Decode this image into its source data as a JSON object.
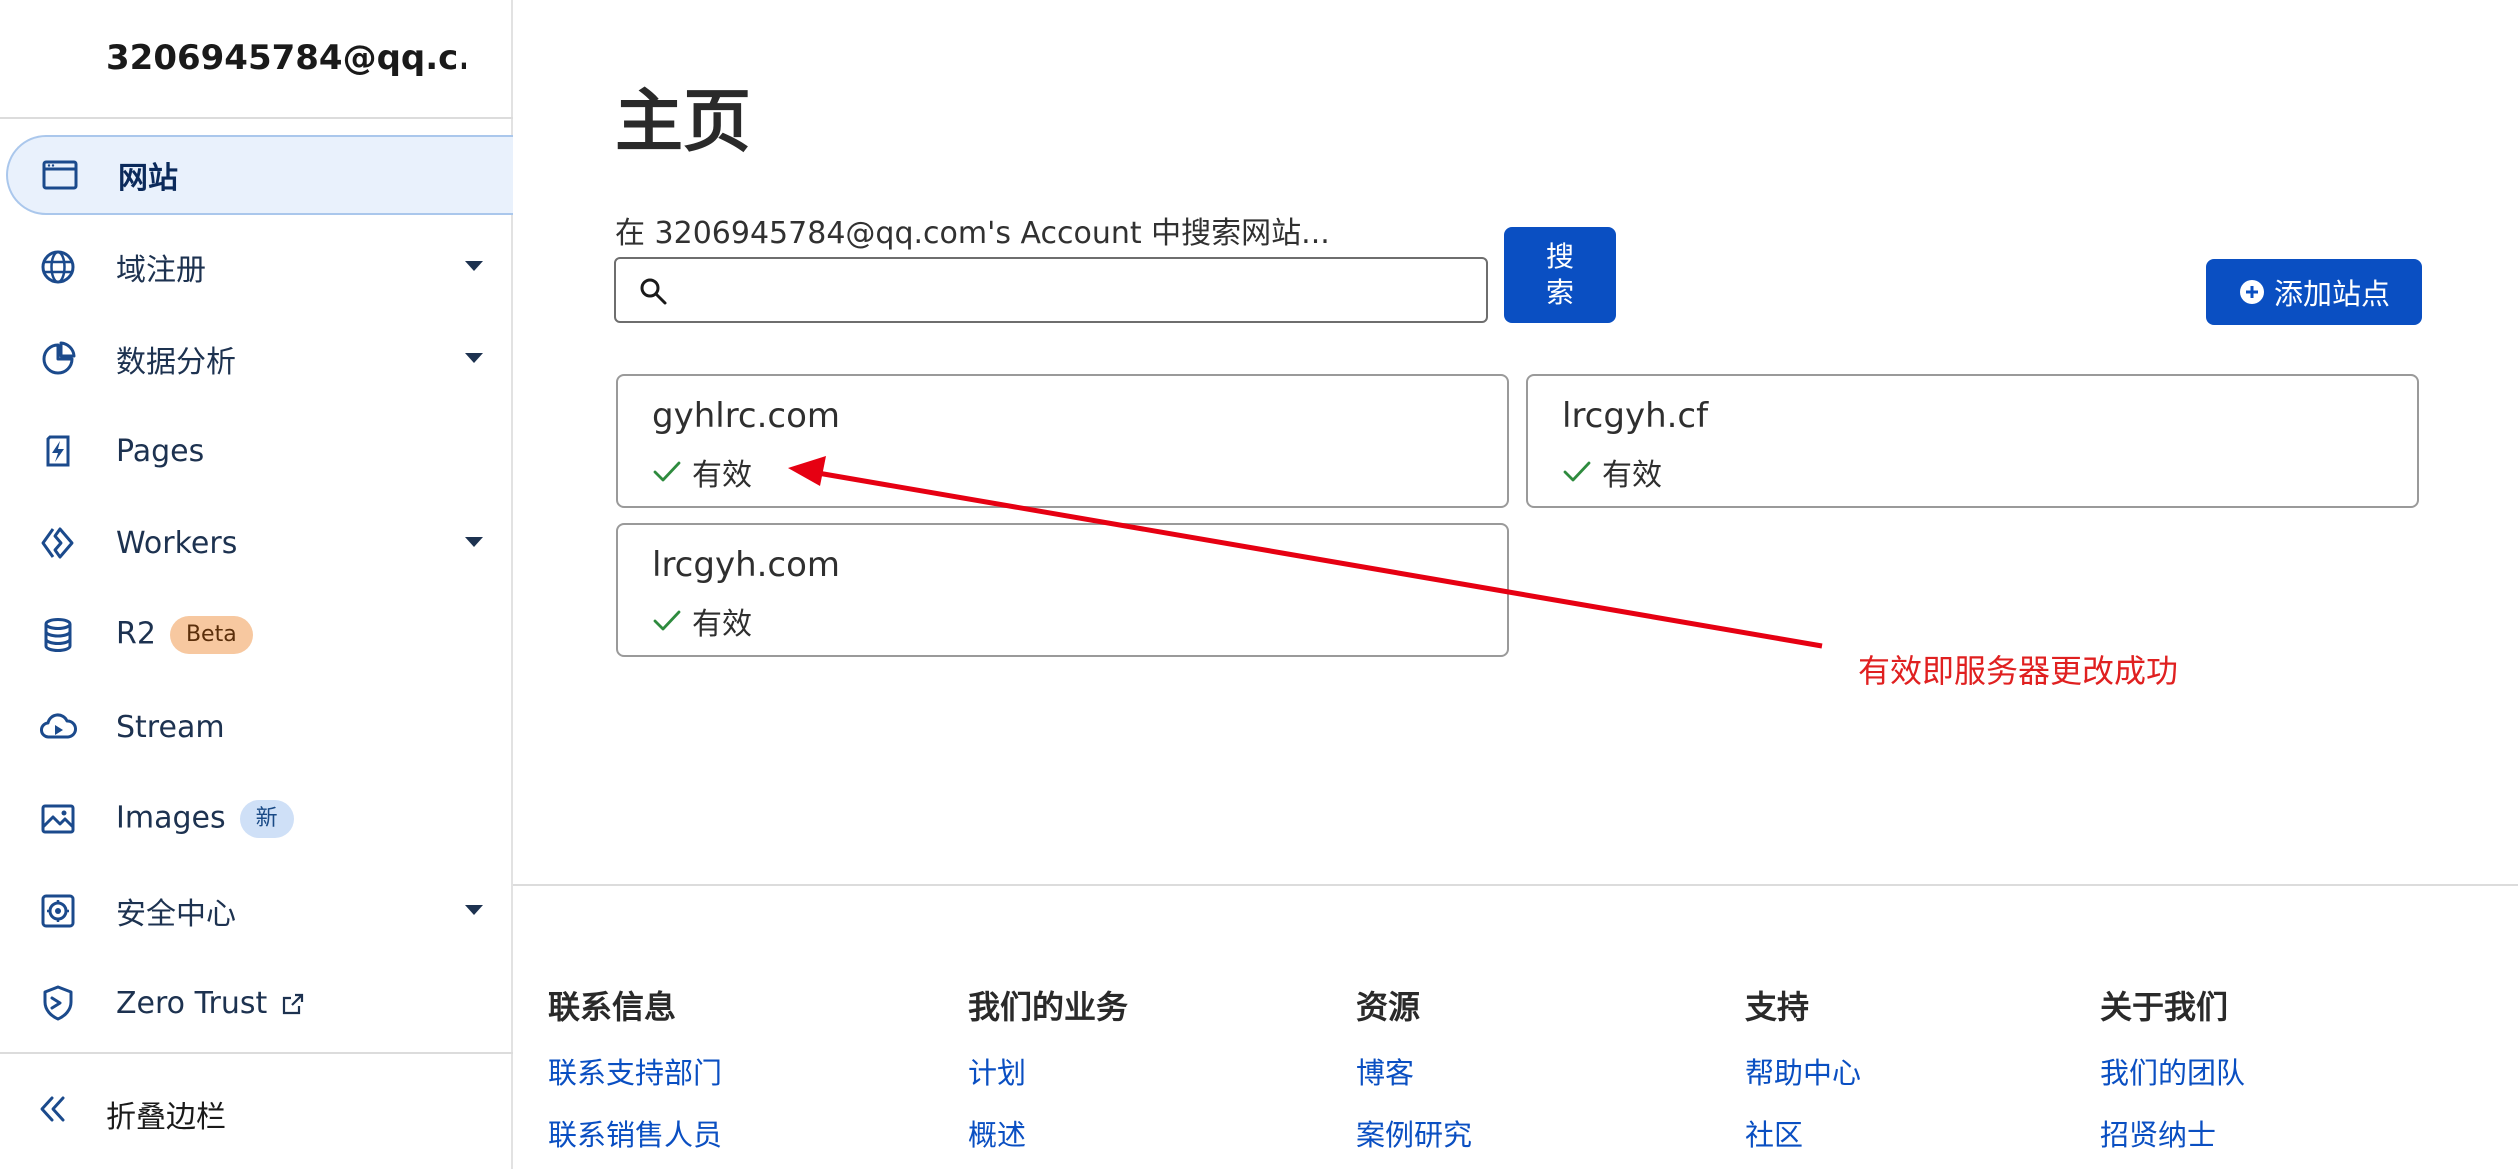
{
  "sidebar": {
    "account": "3206945784@qq.c...",
    "items": [
      {
        "label": "网站",
        "icon": "browser-window-icon",
        "active": true
      },
      {
        "label": "域注册",
        "icon": "globe-icon",
        "has_caret": true
      },
      {
        "label": "数据分析",
        "icon": "pie-chart-icon",
        "has_caret": true
      },
      {
        "label": "Pages",
        "icon": "lightning-page-icon"
      },
      {
        "label": "Workers",
        "icon": "workers-diamond-icon",
        "has_caret": true
      },
      {
        "label": "R2",
        "icon": "database-icon",
        "badge": "Beta"
      },
      {
        "label": "Stream",
        "icon": "cloud-play-icon"
      },
      {
        "label": "Images",
        "icon": "image-icon",
        "badge": "新"
      },
      {
        "label": "安全中心",
        "icon": "security-center-icon",
        "has_caret": true
      },
      {
        "label": "Zero Trust",
        "icon": "zero-trust-shield-icon",
        "external": true
      }
    ],
    "collapse_label": "折叠边栏"
  },
  "main": {
    "title": "主页",
    "search": {
      "label": "在 3206945784@qq.com's Account 中搜索网站...",
      "value": "",
      "placeholder": "",
      "button_label": "搜索"
    },
    "add_site_label": "添加站点",
    "sites": [
      {
        "name": "gyhlrc.com",
        "status": "有效"
      },
      {
        "name": "lrcgyh.cf",
        "status": "有效"
      },
      {
        "name": "lrcgyh.com",
        "status": "有效"
      }
    ],
    "annotation": "有效即服务器更改成功"
  },
  "footer": {
    "columns": [
      {
        "heading": "联系信息",
        "links": [
          "联系支持部门",
          "联系销售人员"
        ]
      },
      {
        "heading": "我们的业务",
        "links": [
          "计划",
          "概述"
        ]
      },
      {
        "heading": "资源",
        "links": [
          "博客",
          "案例研究"
        ]
      },
      {
        "heading": "支持",
        "links": [
          "帮助中心",
          "社区"
        ]
      },
      {
        "heading": "关于我们",
        "links": [
          "我们的团队",
          "招贤纳士"
        ]
      }
    ]
  },
  "colors": {
    "accent": "#0a4fc2",
    "active_nav_bg": "#e9f1fc",
    "success": "#2e8b3e",
    "annotation": "#e02020"
  }
}
